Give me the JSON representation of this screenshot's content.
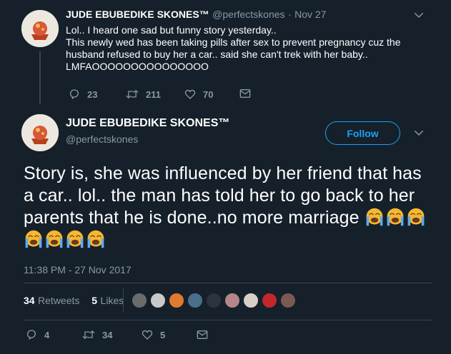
{
  "parent_tweet": {
    "display_name": "JUDE EBUBEDIKE SKONES™",
    "handle": "@perfectskones",
    "separator": "·",
    "date": "Nov 27",
    "text": "Lol.. I heard one sad but funny story yesterday..\nThis newly wed has been taking pills after sex to prevent pregnancy cuz the husband refused to buy her a car.. said she can't trek with her baby..\nLMFAOOOOOOOOOOOOOOO",
    "replies": "23",
    "retweets": "211",
    "likes": "70"
  },
  "main_tweet": {
    "display_name": "JUDE EBUBEDIKE SKONES™",
    "handle": "@perfectskones",
    "follow_label": "Follow",
    "text": "Story is, she was influenced by her friend that has a car.. lol.. the man has told her to go back to her parents that he is done..no more marriage",
    "emoji_count": 7,
    "timestamp": "11:38 PM - 27 Nov 2017",
    "retweet_count": "34",
    "retweet_label": "Retweets",
    "like_count": "5",
    "like_label": "Likes",
    "replies": "4",
    "retweets": "34",
    "likes": "5"
  },
  "icons": {
    "reply": "reply-icon",
    "retweet": "retweet-icon",
    "like": "heart-icon",
    "dm": "envelope-icon",
    "more": "chevron-down-icon",
    "emoji": "loudly-crying-face-icon"
  },
  "colors": {
    "background": "#15202b",
    "accent": "#1da1f2",
    "secondary_text": "#8899a6",
    "divider": "#38444d",
    "emoji": "#f6b731"
  },
  "likers": [
    {
      "name": "liker-avatar",
      "color": "#6b6b6b"
    },
    {
      "name": "liker-avatar",
      "color": "#c9c9c9"
    },
    {
      "name": "liker-avatar",
      "color": "#e07a2f"
    },
    {
      "name": "liker-avatar",
      "color": "#4a6f8a"
    },
    {
      "name": "liker-avatar",
      "color": "#2b3440"
    },
    {
      "name": "liker-avatar",
      "color": "#b5858a"
    },
    {
      "name": "liker-avatar",
      "color": "#d8d0c8"
    },
    {
      "name": "liker-avatar",
      "color": "#c1272d"
    },
    {
      "name": "liker-avatar",
      "color": "#7a5a52"
    }
  ]
}
